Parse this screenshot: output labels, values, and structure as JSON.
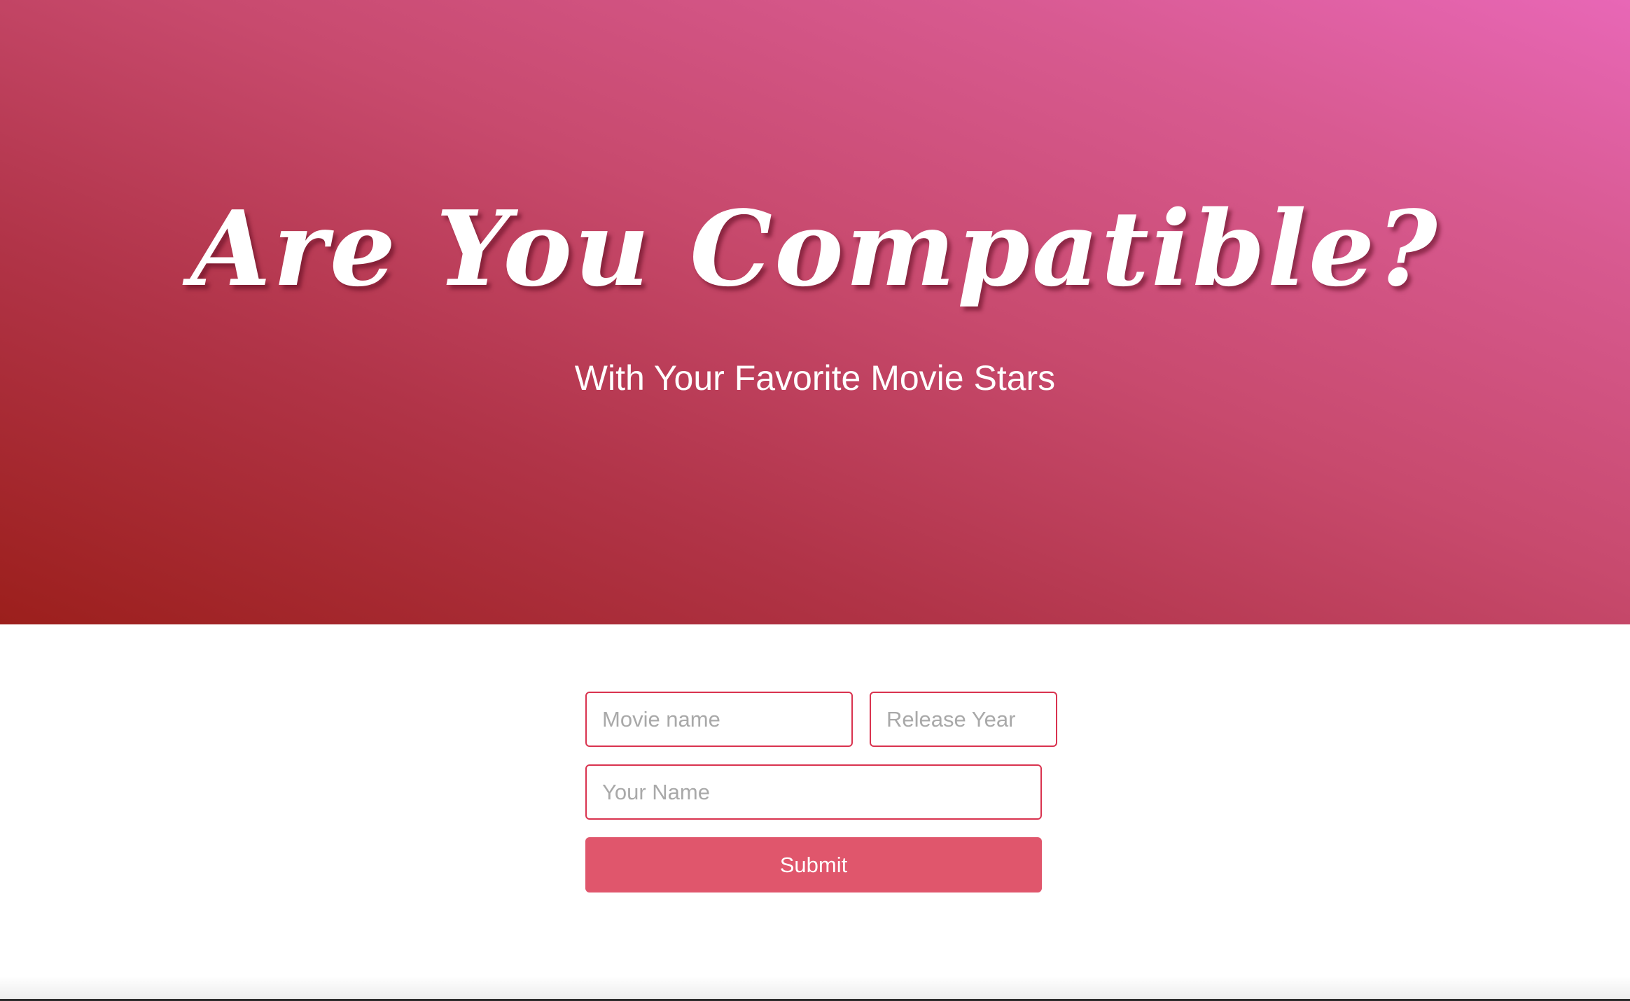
{
  "hero": {
    "title": "Are You Compatible?",
    "subtitle": "With Your Favorite Movie Stars",
    "gradient_colors": [
      "#9c1f1c",
      "#b13448",
      "#c84a6e",
      "#d85a91",
      "#e867b6"
    ]
  },
  "form": {
    "movie_name": {
      "placeholder": "Movie name",
      "value": ""
    },
    "release_year": {
      "placeholder": "Release Year",
      "value": ""
    },
    "your_name": {
      "placeholder": "Your Name",
      "value": ""
    },
    "submit_label": "Submit",
    "accent_color": "#e0566c",
    "border_color": "#d9334f"
  }
}
